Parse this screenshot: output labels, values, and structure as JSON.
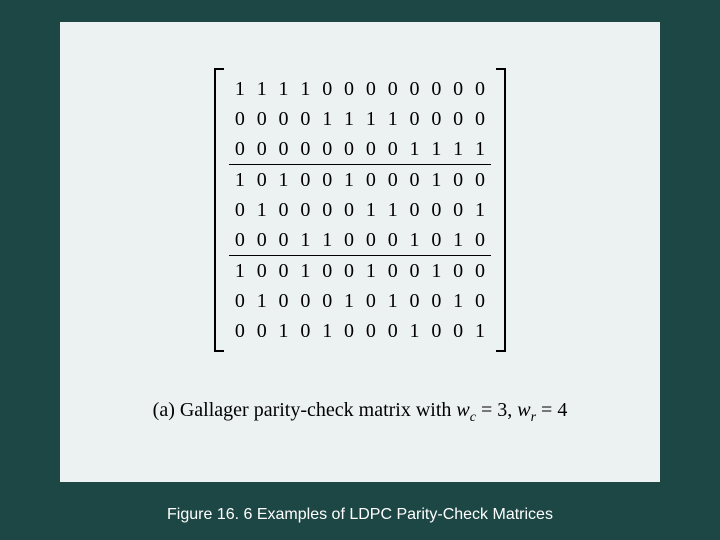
{
  "figure": {
    "caption": "Figure 16. 6 Examples of LDPC Parity-Check Matrices",
    "sub_prefix": "(a) Gallager parity-check matrix with ",
    "wc_sym": "w",
    "wc_sub": "c",
    "wc_val": "3",
    "wr_sym": "w",
    "wr_sub": "r",
    "wr_val": "4",
    "eq": " = ",
    "comma": ", "
  },
  "matrix": {
    "rows": [
      [
        1,
        1,
        1,
        1,
        0,
        0,
        0,
        0,
        0,
        0,
        0,
        0
      ],
      [
        0,
        0,
        0,
        0,
        1,
        1,
        1,
        1,
        0,
        0,
        0,
        0
      ],
      [
        0,
        0,
        0,
        0,
        0,
        0,
        0,
        0,
        1,
        1,
        1,
        1
      ],
      [
        1,
        0,
        1,
        0,
        0,
        1,
        0,
        0,
        0,
        1,
        0,
        0
      ],
      [
        0,
        1,
        0,
        0,
        0,
        0,
        1,
        1,
        0,
        0,
        0,
        1
      ],
      [
        0,
        0,
        0,
        1,
        1,
        0,
        0,
        0,
        1,
        0,
        1,
        0
      ],
      [
        1,
        0,
        0,
        1,
        0,
        0,
        1,
        0,
        0,
        1,
        0,
        0
      ],
      [
        0,
        1,
        0,
        0,
        0,
        1,
        0,
        1,
        0,
        0,
        1,
        0
      ],
      [
        0,
        0,
        1,
        0,
        1,
        0,
        0,
        0,
        1,
        0,
        0,
        1
      ]
    ],
    "block_breaks": [
      3,
      6
    ]
  }
}
